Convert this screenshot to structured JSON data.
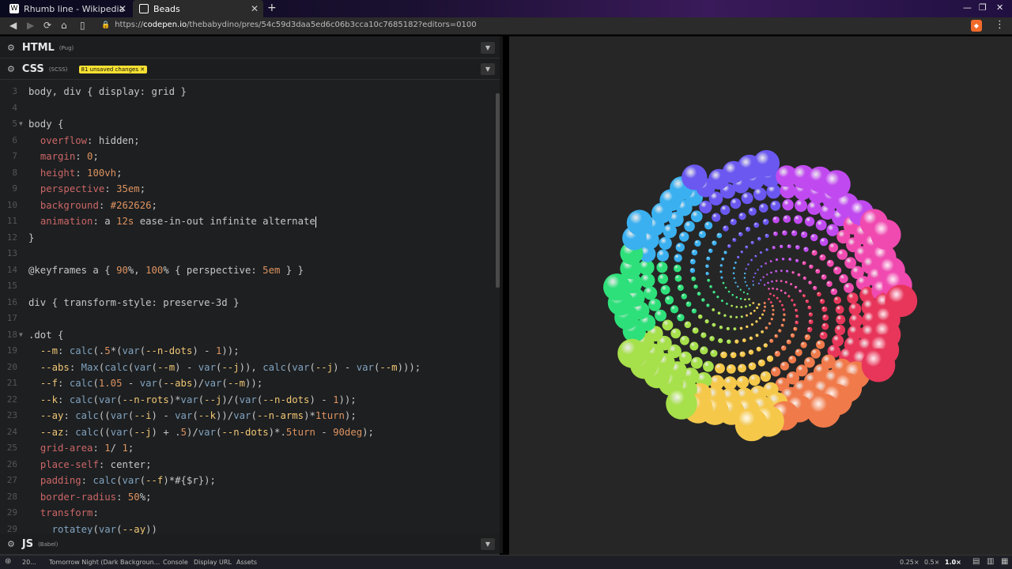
{
  "browser": {
    "tabs": [
      {
        "title": "Rhumb line - Wikipedia",
        "favicon": "W"
      },
      {
        "title": "Beads",
        "favicon": "codepen"
      }
    ],
    "url_prefix": "https://",
    "url_host": "codepen.io",
    "url_path": "/thebabydino/pres/54c59d3daa5ed6c06b3cca10c7685182?editors=0100"
  },
  "panels": {
    "html": {
      "title": "HTML",
      "sub": "(Pug)"
    },
    "css": {
      "title": "CSS",
      "sub": "(SCSS)",
      "badge": "81 unsaved changes ✕"
    },
    "js": {
      "title": "JS",
      "sub": "(Babel)"
    }
  },
  "code": {
    "line_numbers": [
      "3",
      "4",
      "5",
      "6",
      "7",
      "8",
      "9",
      "10",
      "11",
      "12",
      "13",
      "14",
      "15",
      "16",
      "17",
      "18",
      "19",
      "20",
      "21",
      "22",
      "23",
      "24",
      "25",
      "26",
      "27",
      "28",
      "29"
    ],
    "lines": [
      "body, div { display: grid }",
      "",
      "body {",
      "  overflow: hidden;",
      "  margin: 0;",
      "  height: 100vh;",
      "  perspective: 35em;",
      "  background: #262626;",
      "  animation: a 12s ease-in-out infinite alternate",
      "}",
      "",
      "@keyframes a { 90%, 100% { perspective: 5em } }",
      "",
      "div { transform-style: preserve-3d }",
      "",
      ".dot {",
      "  --m: calc(.5*(var(--n-dots) - 1));",
      "  --abs: Max(calc(var(--m) - var(--j)), calc(var(--j) - var(--m)));",
      "  --f: calc(1.05 - var(--abs)/var(--m));",
      "  --k: calc(var(--n-rots)*var(--j)/(var(--n-dots) - 1));",
      "  --ay: calc((var(--i) - var(--k))/var(--n-arms)*1turn);",
      "  --az: calc((var(--j) + .5)/var(--n-dots)*.5turn - 90deg);",
      "  grid-area: 1/ 1;",
      "  place-self: center;",
      "  padding: calc(var(--f)*#{$r});",
      "  border-radius: 50%;",
      "  transform:"
    ],
    "partial_line": "    rotatey(var(--ay))"
  },
  "footer": {
    "count": "20...",
    "theme": "Tomorrow Night (Dark Backgroun...",
    "console": "Console",
    "display_url": "Display URL",
    "assets": "Assets",
    "zoom_options": [
      "0.25×",
      "0.5×",
      "1.0×"
    ],
    "zoom_selected": "1.0×"
  },
  "preview": {
    "background": "#262626",
    "bead_palette": [
      "#e8365a",
      "#f07a4a",
      "#f5c84a",
      "#a6e04a",
      "#2ee07a",
      "#3ab0f0",
      "#6a58f0",
      "#c04af0",
      "#f04ab0"
    ]
  }
}
